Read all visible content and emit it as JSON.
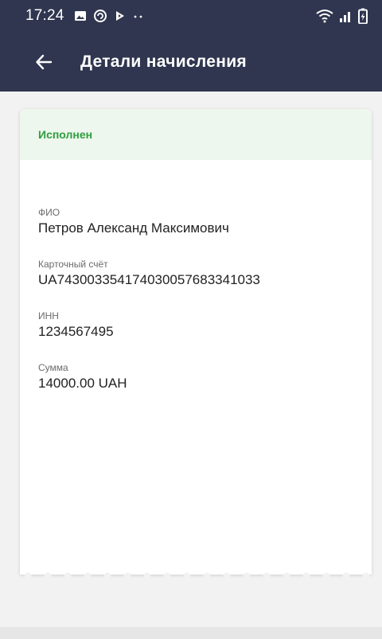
{
  "status_bar": {
    "time": "17:24",
    "left_icons": [
      "image-icon",
      "refresh-icon",
      "play-icon",
      "more-dots-icon"
    ],
    "right_icons": [
      "wifi-icon",
      "signal-icon",
      "battery-icon"
    ]
  },
  "app_bar": {
    "title": "Детали начисления",
    "back_icon": "arrow-left-icon"
  },
  "card": {
    "status": "Исполнен",
    "status_color": "#2e9e3e",
    "fields": [
      {
        "label": "ФИО",
        "value": "Петров Александ Максимович"
      },
      {
        "label": "Карточный счёт",
        "value": "UA743003354174030057683341033"
      },
      {
        "label": "ИНН",
        "value": "1234567495"
      },
      {
        "label": "Сумма",
        "value": "14000.00 UAH"
      }
    ]
  },
  "colors": {
    "header": "#30364f",
    "background": "#f2f2f2",
    "card": "#ffffff",
    "status_bg": "#edf7ed"
  }
}
